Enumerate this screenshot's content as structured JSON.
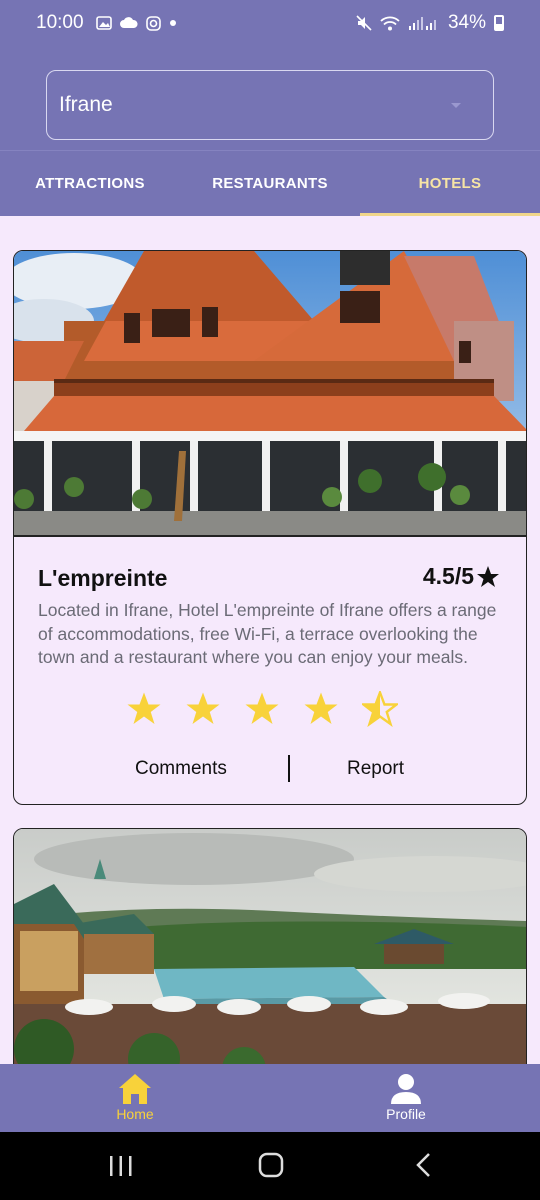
{
  "status_bar": {
    "time": "10:00",
    "battery": "34%",
    "icons": [
      "gallery-icon",
      "cloud-icon",
      "instagram-icon",
      "dot-icon",
      "mute-icon",
      "wifi-icon",
      "signal-icon",
      "battery-icon"
    ]
  },
  "city_select": {
    "value": "Ifrane"
  },
  "tabs": [
    {
      "label": "ATTRACTIONS",
      "active": false
    },
    {
      "label": "RESTAURANTS",
      "active": false
    },
    {
      "label": "HOTELS",
      "active": true
    }
  ],
  "hotels": [
    {
      "name": "L'empreinte",
      "rating_text": "4.5/5",
      "rating_value": 4.5,
      "description": "Located in Ifrane, Hotel L'empreinte of Ifrane offers a range of accommodations, free Wi-Fi, a terrace overlooking the town and a restaurant where you can enjoy your meals.",
      "comments_label": "Comments",
      "report_label": "Report"
    }
  ],
  "bottom_nav": [
    {
      "label": "Home",
      "icon": "home-icon",
      "active": true
    },
    {
      "label": "Profile",
      "icon": "profile-icon",
      "active": false
    }
  ],
  "colors": {
    "primary": "#7674b4",
    "background": "#f6e9fc",
    "active_tab": "#f7e5a5",
    "star": "#f8d23a",
    "nav_active": "#f8d23a"
  }
}
